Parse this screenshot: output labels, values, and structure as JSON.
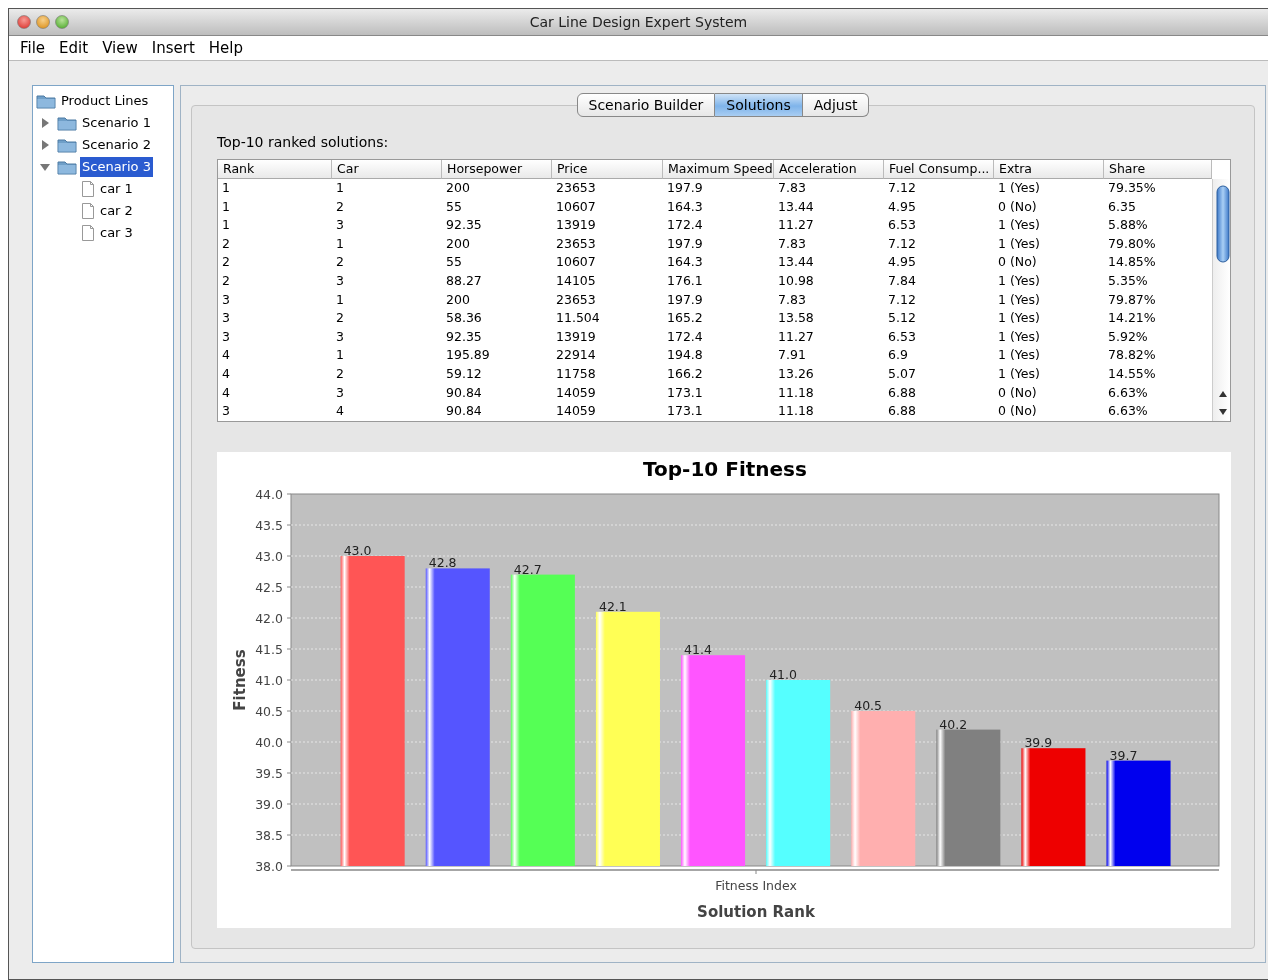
{
  "window": {
    "title": "Car Line Design Expert System"
  },
  "menu": [
    "File",
    "Edit",
    "View",
    "Insert",
    "Help"
  ],
  "tree": {
    "label": "Product Lines",
    "selected": false,
    "children": [
      {
        "label": "Scenario 1",
        "expanded": false,
        "selected": false
      },
      {
        "label": "Scenario 2",
        "expanded": false,
        "selected": false
      },
      {
        "label": "Scenario 3",
        "expanded": true,
        "selected": true,
        "children": [
          {
            "label": "car 1",
            "selected": false
          },
          {
            "label": "car 2",
            "selected": false
          },
          {
            "label": "car 3",
            "selected": false
          }
        ]
      }
    ]
  },
  "tabs": [
    {
      "label": "Scenario Builder",
      "selected": false
    },
    {
      "label": "Solutions",
      "selected": true
    },
    {
      "label": "Adjust",
      "selected": false
    }
  ],
  "table": {
    "caption": "Top-10 ranked solutions:",
    "columns": [
      "Rank",
      "Car",
      "Horsepower",
      "Price",
      "Maximum Speed",
      "Acceleration",
      "Fuel Consump...",
      "Extra",
      "Share"
    ],
    "rows": [
      [
        "1",
        "1",
        "200",
        "23653",
        "197.9",
        "7.83",
        "7.12",
        "1 (Yes)",
        "79.35%"
      ],
      [
        "1",
        "2",
        "55",
        "10607",
        "164.3",
        "13.44",
        "4.95",
        "0 (No)",
        "6.35"
      ],
      [
        "1",
        "3",
        "92.35",
        "13919",
        "172.4",
        "11.27",
        "6.53",
        "1 (Yes)",
        "5.88%"
      ],
      [
        "2",
        "1",
        "200",
        "23653",
        "197.9",
        "7.83",
        "7.12",
        "1 (Yes)",
        "79.80%"
      ],
      [
        "2",
        "2",
        "55",
        "10607",
        "164.3",
        "13.44",
        "4.95",
        "0 (No)",
        "14.85%"
      ],
      [
        "2",
        "3",
        "88.27",
        "14105",
        "176.1",
        "10.98",
        "7.84",
        "1 (Yes)",
        "5.35%"
      ],
      [
        "3",
        "1",
        "200",
        "23653",
        "197.9",
        "7.83",
        "7.12",
        "1 (Yes)",
        "79.87%"
      ],
      [
        "3",
        "2",
        "58.36",
        "11.504",
        "165.2",
        "13.58",
        "5.12",
        "1 (Yes)",
        "14.21%"
      ],
      [
        "3",
        "3",
        "92.35",
        "13919",
        "172.4",
        "11.27",
        "6.53",
        "1 (Yes)",
        "5.92%"
      ],
      [
        "4",
        "1",
        "195.89",
        "22914",
        "194.8",
        "7.91",
        "6.9",
        "1 (Yes)",
        "78.82%"
      ],
      [
        "4",
        "2",
        "59.12",
        "11758",
        "166.2",
        "13.26",
        "5.07",
        "1 (Yes)",
        "14.55%"
      ],
      [
        "4",
        "3",
        "90.84",
        "14059",
        "173.1",
        "11.18",
        "6.88",
        "0 (No)",
        "6.63%"
      ],
      [
        "3",
        "4",
        "90.84",
        "14059",
        "173.1",
        "11.18",
        "6.88",
        "0 (No)",
        "6.63%"
      ]
    ]
  },
  "chart": {
    "chart_data": {
      "type": "bar",
      "title": "Top-10 Fitness",
      "xlabel": "Solution Rank",
      "ylabel": "Fitness",
      "categories": [
        "Fitness Index"
      ],
      "ylim": [
        38,
        44
      ],
      "yticks": [
        {
          "value": 38,
          "label": "38.0"
        },
        {
          "value": 38.5,
          "label": "38.5"
        },
        {
          "value": 39,
          "label": "39.0"
        },
        {
          "value": 39.5,
          "label": "39.5"
        },
        {
          "value": 40,
          "label": "40.0"
        },
        {
          "value": 40.5,
          "label": "40.5"
        },
        {
          "value": 41,
          "label": "41.0"
        },
        {
          "value": 41.5,
          "label": "41.5"
        },
        {
          "value": 42,
          "label": "42.0"
        },
        {
          "value": 42.5,
          "label": "42.5"
        },
        {
          "value": 43,
          "label": "43.0"
        },
        {
          "value": 43.5,
          "label": "43.5"
        },
        {
          "value": 44,
          "label": "44.0"
        }
      ],
      "grid": true,
      "value_labels": [
        "43.0",
        "42.8",
        "42.7",
        "42.1",
        "41.4",
        "41.0",
        "40.5",
        "40.2",
        "39.9",
        "39.7"
      ],
      "series": [
        {
          "color": "#ff5555",
          "values": [
            43.0
          ]
        },
        {
          "color": "#5555ff",
          "values": [
            42.8
          ]
        },
        {
          "color": "#55ff55",
          "values": [
            42.7
          ]
        },
        {
          "color": "#ffff55",
          "values": [
            42.1
          ]
        },
        {
          "color": "#ff55ff",
          "values": [
            41.4
          ]
        },
        {
          "color": "#55ffff",
          "values": [
            41.0
          ]
        },
        {
          "color": "#ffafaf",
          "values": [
            40.5
          ]
        },
        {
          "color": "#808080",
          "values": [
            40.2
          ]
        },
        {
          "color": "#ee0000",
          "values": [
            39.9
          ]
        },
        {
          "color": "#0000ee",
          "values": [
            39.7
          ]
        }
      ]
    }
  }
}
